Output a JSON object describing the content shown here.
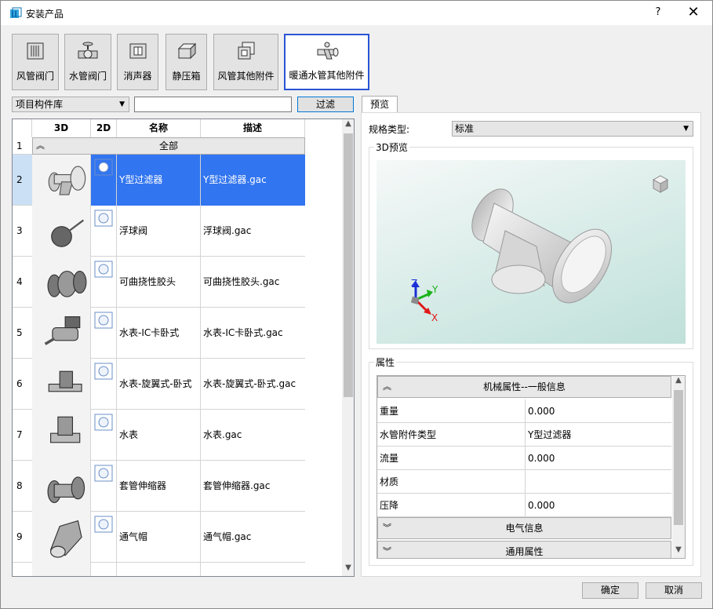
{
  "window": {
    "title": "安装产品",
    "help": "?",
    "close": "✕"
  },
  "categories": [
    {
      "label": "风管阀门",
      "icon": "duct-valve-icon"
    },
    {
      "label": "水管阀门",
      "icon": "water-valve-icon"
    },
    {
      "label": "消声器",
      "icon": "silencer-icon"
    },
    {
      "label": "静压箱",
      "icon": "plenum-box-icon"
    },
    {
      "label": "风管其他附件",
      "icon": "duct-accessory-icon"
    },
    {
      "label": "暖通水管其他附件",
      "icon": "hvac-pipe-accessory-icon"
    }
  ],
  "library": {
    "selected": "项目构件库",
    "filter_value": "",
    "filter_button": "过滤"
  },
  "grid": {
    "headers": [
      "3D",
      "2D",
      "名称",
      "描述"
    ],
    "all_row": {
      "num": "1",
      "label": "全部"
    },
    "rows": [
      {
        "num": "2",
        "name": "Y型过滤器",
        "desc": "Y型过滤器.gac"
      },
      {
        "num": "3",
        "name": "浮球阀",
        "desc": "浮球阀.gac"
      },
      {
        "num": "4",
        "name": "可曲挠性胶头",
        "desc": "可曲挠性胶头.gac"
      },
      {
        "num": "5",
        "name": "水表-IC卡卧式",
        "desc": "水表-IC卡卧式.gac"
      },
      {
        "num": "6",
        "name": "水表-旋翼式-卧式",
        "desc": "水表-旋翼式-卧式.gac"
      },
      {
        "num": "7",
        "name": "水表",
        "desc": "水表.gac"
      },
      {
        "num": "8",
        "name": "套管伸缩器",
        "desc": "套管伸缩器.gac"
      },
      {
        "num": "9",
        "name": "通气帽",
        "desc": "通气帽.gac"
      }
    ]
  },
  "preview": {
    "tab": "预览",
    "spec_label": "规格类型:",
    "spec_value": "标准",
    "preview_group": "3D预览",
    "axis": {
      "x": "X",
      "y": "Y",
      "z": "Z"
    }
  },
  "properties": {
    "group": "属性",
    "section_mech": "机械属性--一般信息",
    "rows": [
      {
        "key": "重量",
        "value": "0.000"
      },
      {
        "key": "水管附件类型",
        "value": "Y型过滤器"
      },
      {
        "key": "流量",
        "value": "0.000"
      },
      {
        "key": "材质",
        "value": ""
      },
      {
        "key": "压降",
        "value": "0.000"
      }
    ],
    "section_elec": "电气信息",
    "section_general": "通用属性"
  },
  "buttons": {
    "ok": "确定",
    "cancel": "取消"
  }
}
